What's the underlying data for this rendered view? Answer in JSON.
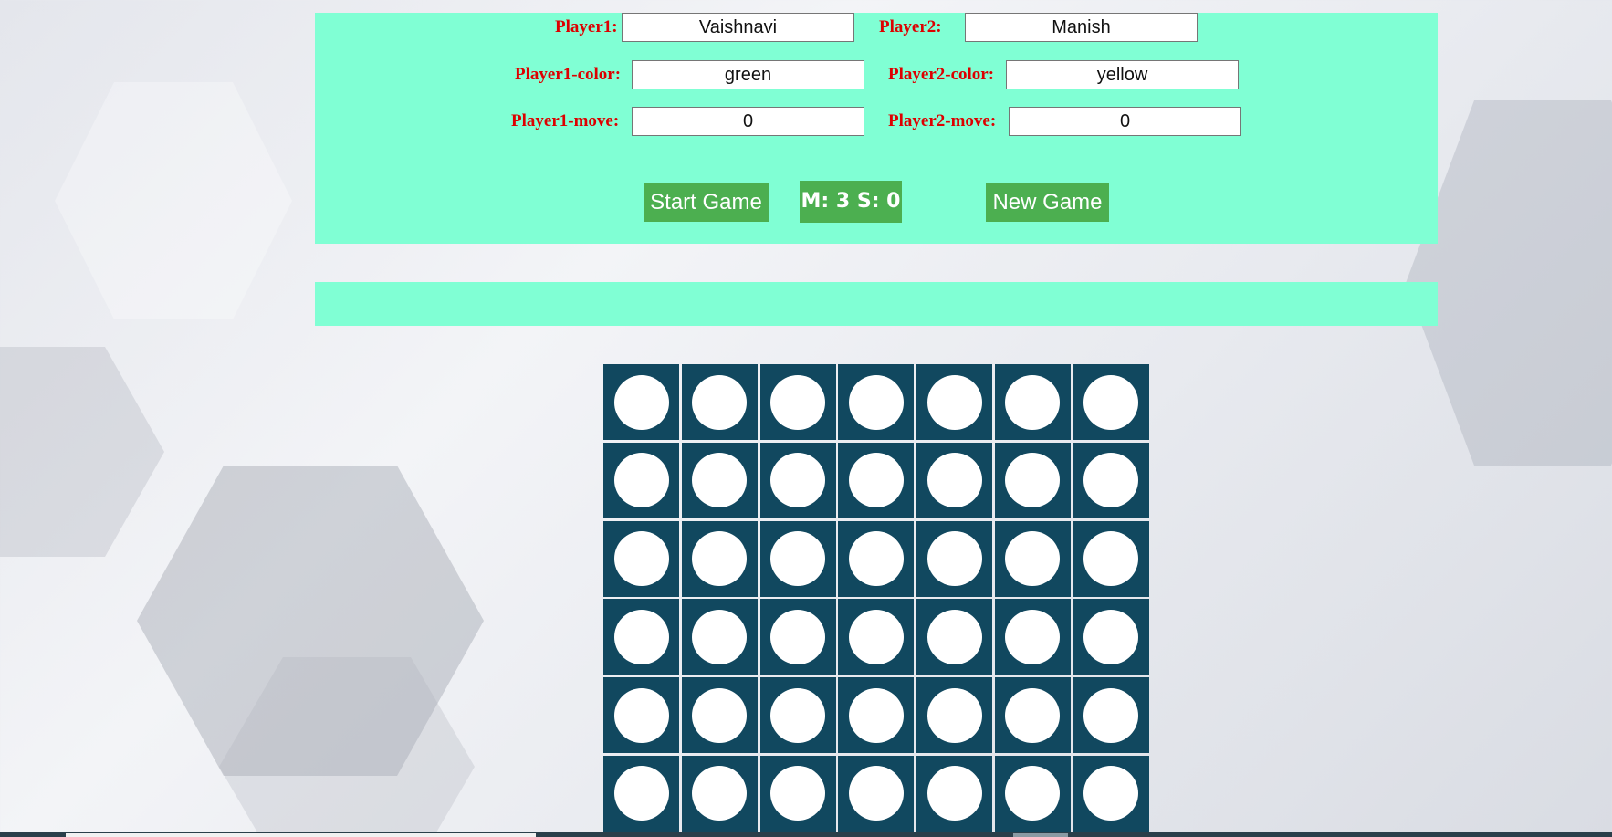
{
  "players": {
    "player1_label": "Player1:",
    "player1_name": "Vaishnavi",
    "player2_label": "Player2:",
    "player2_name": "Manish",
    "player1_color_label": "Player1-color:",
    "player1_color": "green",
    "player2_color_label": "Player2-color:",
    "player2_color": "yellow",
    "player1_move_label": "Player1-move:",
    "player1_move": "0",
    "player2_move_label": "Player2-move:",
    "player2_move": "0"
  },
  "controls": {
    "start_label": "Start Game",
    "timer": "M: 3 S: 0",
    "new_label": "New Game"
  },
  "message": "",
  "board": {
    "rows": 6,
    "columns": 7,
    "cells": [
      [
        "empty",
        "empty",
        "empty",
        "empty",
        "empty",
        "empty",
        "empty"
      ],
      [
        "empty",
        "empty",
        "empty",
        "empty",
        "empty",
        "empty",
        "empty"
      ],
      [
        "empty",
        "empty",
        "empty",
        "empty",
        "empty",
        "empty",
        "empty"
      ],
      [
        "empty",
        "empty",
        "empty",
        "empty",
        "empty",
        "empty",
        "empty"
      ],
      [
        "empty",
        "empty",
        "empty",
        "empty",
        "empty",
        "empty",
        "empty"
      ],
      [
        "empty",
        "empty",
        "empty",
        "empty",
        "empty",
        "empty",
        "empty"
      ]
    ]
  },
  "colors": {
    "panel": "#80ffd4",
    "label": "#dd0000",
    "button": "#4caf50",
    "board_cell": "#11485f",
    "empty_disc": "#ffffff"
  }
}
